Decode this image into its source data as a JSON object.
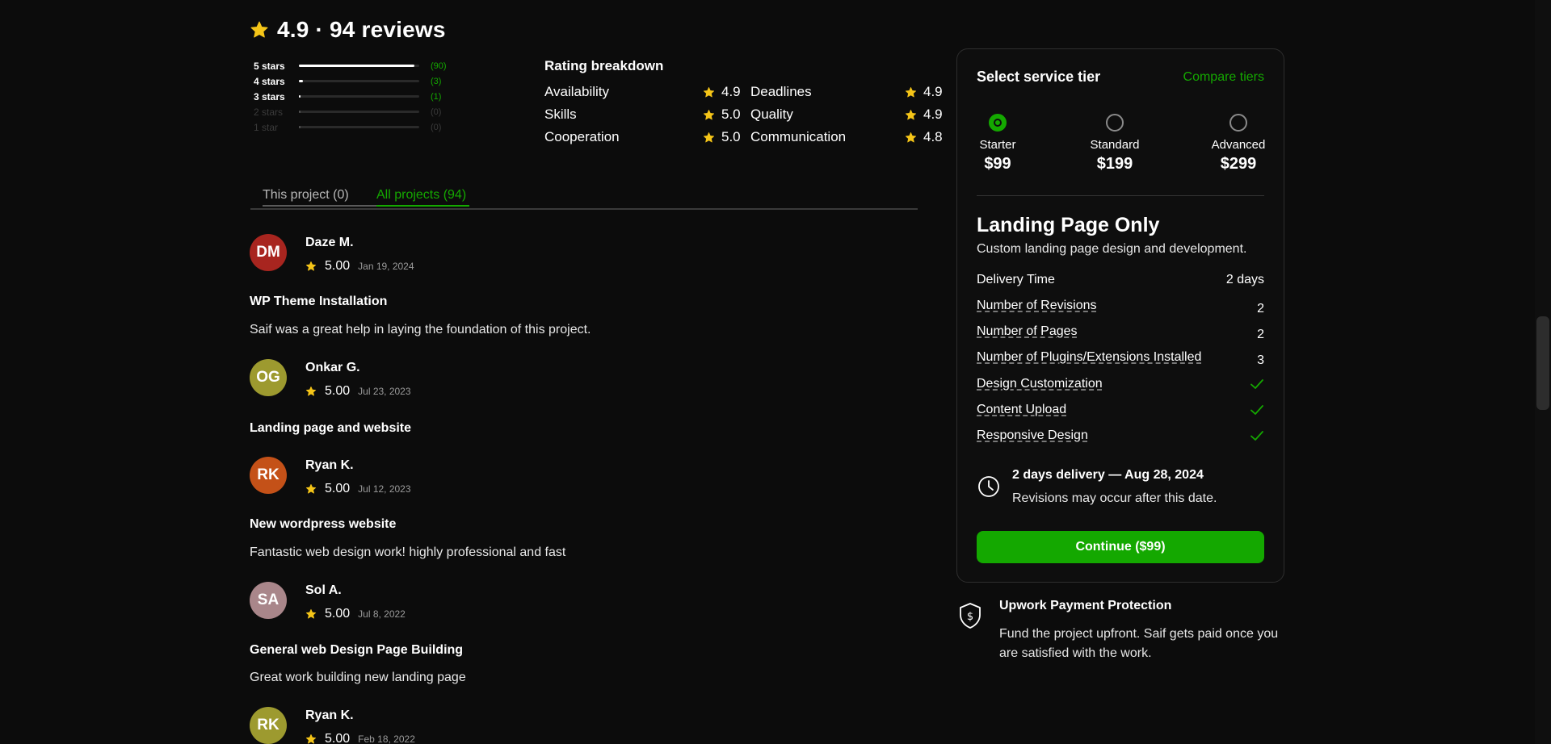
{
  "summary": {
    "text": "4.9 · 94 reviews"
  },
  "star_bars": [
    {
      "label": "5 stars",
      "count": "(90)",
      "fraction": 0.957,
      "dim": false
    },
    {
      "label": "4 stars",
      "count": "(3)",
      "fraction": 0.032,
      "dim": false
    },
    {
      "label": "3 stars",
      "count": "(1)",
      "fraction": 0.011,
      "dim": false
    },
    {
      "label": "2 stars",
      "count": "(0)",
      "fraction": 0,
      "dim": true
    },
    {
      "label": "1 star",
      "count": "(0)",
      "fraction": 0,
      "dim": true
    }
  ],
  "breakdown": {
    "title": "Rating breakdown",
    "items": [
      {
        "label": "Availability",
        "score": "4.9"
      },
      {
        "label": "Deadlines",
        "score": "4.9"
      },
      {
        "label": "Skills",
        "score": "5.0"
      },
      {
        "label": "Quality",
        "score": "4.9"
      },
      {
        "label": "Cooperation",
        "score": "5.0"
      },
      {
        "label": "Communication",
        "score": "4.8"
      }
    ]
  },
  "tabs": {
    "this_project": "This project (0)",
    "all_projects": "All projects (94)"
  },
  "reviews": [
    {
      "initials": "DM",
      "avatar_color": "#a8251f",
      "name": "Daze M.",
      "score": "5.00",
      "date": "Jan 19, 2024",
      "title": "WP Theme Installation",
      "body": "Saif was a great help in laying the foundation of this project."
    },
    {
      "initials": "OG",
      "avatar_color": "#9d9a2f",
      "name": "Onkar G.",
      "score": "5.00",
      "date": "Jul 23, 2023",
      "title": "Landing page and website",
      "body": ""
    },
    {
      "initials": "RK",
      "avatar_color": "#c45118",
      "name": "Ryan K.",
      "score": "5.00",
      "date": "Jul 12, 2023",
      "title": "New wordpress website",
      "body": "Fantastic web design work! highly professional and fast"
    },
    {
      "initials": "SA",
      "avatar_color": "#a9868a",
      "name": "Sol A.",
      "score": "5.00",
      "date": "Jul 8, 2022",
      "title": "General web Design Page Building",
      "body": "Great work building new landing page"
    },
    {
      "initials": "RK",
      "avatar_color": "#9d9a2f",
      "name": "Ryan K.",
      "score": "5.00",
      "date": "Feb 18, 2022",
      "title": "",
      "body": ""
    }
  ],
  "panel": {
    "title": "Select service tier",
    "compare": "Compare tiers",
    "tiers": [
      {
        "name": "Starter",
        "price": "$99",
        "selected": true
      },
      {
        "name": "Standard",
        "price": "$199",
        "selected": false
      },
      {
        "name": "Advanced",
        "price": "$299",
        "selected": false
      }
    ],
    "package_title": "Landing Page Only",
    "package_desc": "Custom landing page design and development.",
    "features": [
      {
        "label": "Delivery Time",
        "value": "2 days",
        "underline": false,
        "check": false
      },
      {
        "label": "Number of Revisions",
        "value": "2",
        "underline": true,
        "check": false
      },
      {
        "label": "Number of Pages",
        "value": "2",
        "underline": true,
        "check": false
      },
      {
        "label": "Number of Plugins/Extensions Installed",
        "value": "3",
        "underline": true,
        "check": false
      },
      {
        "label": "Design Customization",
        "value": "",
        "underline": true,
        "check": true
      },
      {
        "label": "Content Upload",
        "value": "",
        "underline": true,
        "check": true
      },
      {
        "label": "Responsive Design",
        "value": "",
        "underline": true,
        "check": true
      }
    ],
    "delivery_line1": "2 days delivery — Aug 28, 2024",
    "delivery_line2": "Revisions may occur after this date.",
    "cta": "Continue ($99)"
  },
  "protection": {
    "title": "Upwork Payment Protection",
    "body": "Fund the project upfront. Saif gets paid once you are satisfied with the work."
  },
  "colors": {
    "accent": "#14a800",
    "star": "#f5c518",
    "background": "#0c0c0c"
  }
}
